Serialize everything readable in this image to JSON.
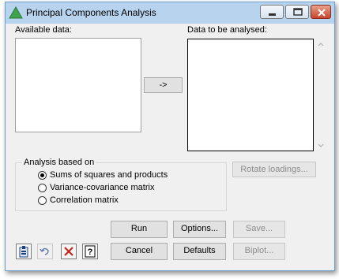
{
  "window": {
    "title": "Principal Components Analysis"
  },
  "labels": {
    "available_data": "Available data:",
    "data_to_be_analysed": "Data to be analysed:",
    "analysis_based_on": "Analysis based on"
  },
  "transfer_button": "->",
  "rotate_loadings_button": "Rotate loadings...",
  "analysis_options": [
    {
      "label": "Sums of squares and products",
      "selected": true
    },
    {
      "label": "Variance-covariance matrix",
      "selected": false
    },
    {
      "label": "Correlation matrix",
      "selected": false
    }
  ],
  "buttons": {
    "run": "Run",
    "options": "Options...",
    "save": "Save...",
    "cancel": "Cancel",
    "defaults": "Defaults",
    "biplot": "Biplot..."
  },
  "toolbar_icons": [
    "clipboard-icon",
    "undo-icon",
    "clear-icon",
    "help-icon"
  ],
  "colors": {
    "titlebar": "#b8d3ee",
    "close_button": "#c8452c",
    "dialog_background": "#f0f0f0"
  }
}
